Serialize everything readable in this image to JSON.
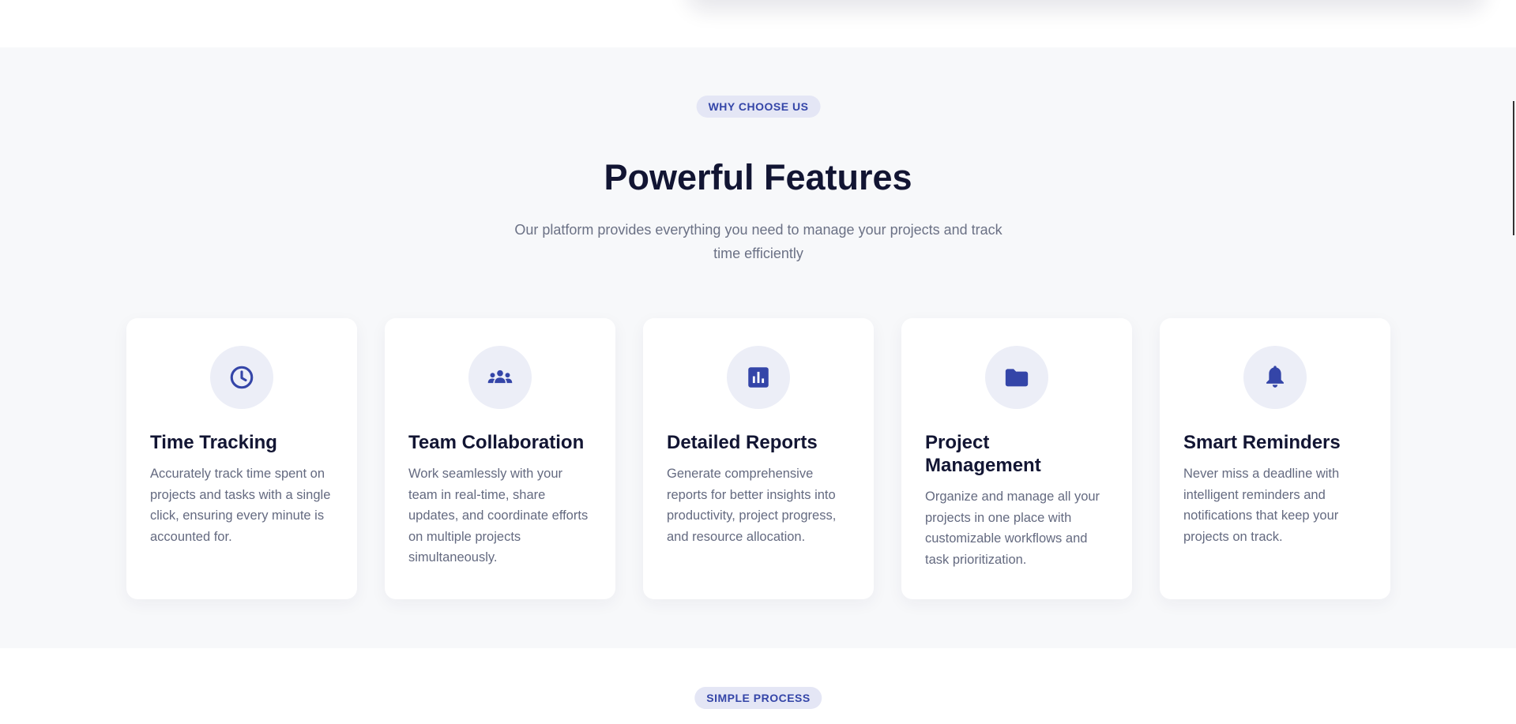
{
  "features": {
    "badge": "WHY CHOOSE US",
    "title": "Powerful Features",
    "subtitle": "Our platform provides everything you need to manage your projects and track time efficiently",
    "accent_color": "#3445a8",
    "cards": [
      {
        "icon": "clock-icon",
        "title": "Time Tracking",
        "description": "Accurately track time spent on projects and tasks with a single click, ensuring every minute is accounted for."
      },
      {
        "icon": "team-icon",
        "title": "Team Collaboration",
        "description": "Work seamlessly with your team in real-time, share updates, and coordinate efforts on multiple projects simultaneously."
      },
      {
        "icon": "bar-chart-icon",
        "title": "Detailed Reports",
        "description": "Generate comprehensive reports for better insights into productivity, project progress, and resource allocation."
      },
      {
        "icon": "folder-icon",
        "title": "Project Management",
        "description": "Organize and manage all your projects in one place with customizable workflows and task prioritization."
      },
      {
        "icon": "bell-icon",
        "title": "Smart Reminders",
        "description": "Never miss a deadline with intelligent reminders and notifications that keep your projects on track."
      }
    ]
  },
  "process": {
    "badge": "SIMPLE PROCESS"
  }
}
